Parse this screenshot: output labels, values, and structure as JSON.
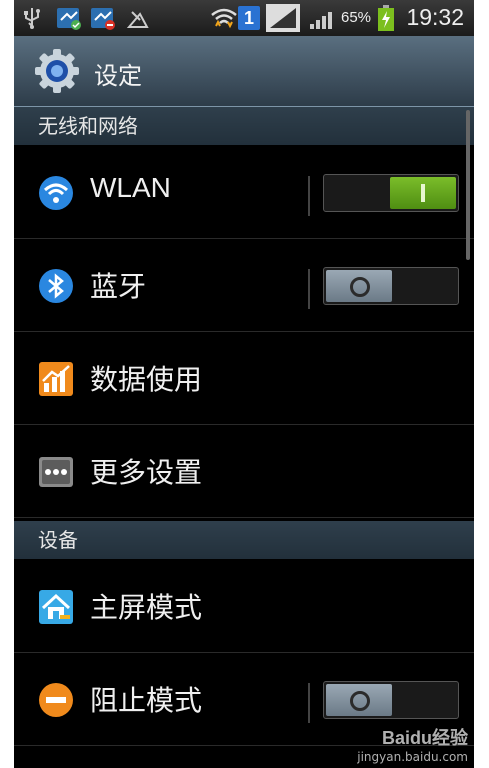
{
  "status_bar": {
    "battery_percent": "65%",
    "time": "19:32",
    "sim_slot": "1"
  },
  "title_bar": {
    "title": "设定",
    "icon": "settings-gear-icon"
  },
  "sections": [
    {
      "header": "无线和网络",
      "items": [
        {
          "label": "WLAN",
          "icon": "wifi-icon",
          "toggle": "on"
        },
        {
          "label": "蓝牙",
          "icon": "bluetooth-icon",
          "toggle": "off"
        },
        {
          "label": "数据使用",
          "icon": "data-usage-icon"
        },
        {
          "label": "更多设置",
          "icon": "more-settings-icon"
        }
      ]
    },
    {
      "header": "设备",
      "items": [
        {
          "label": "主屏模式",
          "icon": "home-screen-icon"
        },
        {
          "label": "阻止模式",
          "icon": "blocking-mode-icon",
          "toggle": "off"
        }
      ]
    }
  ],
  "watermark": {
    "brand": "Baidu经验",
    "url": "jingyan.baidu.com"
  },
  "colors": {
    "toggle_on": "#5f9f1a",
    "toggle_off": "#7d8b97",
    "header_bg": "#2a3844"
  }
}
